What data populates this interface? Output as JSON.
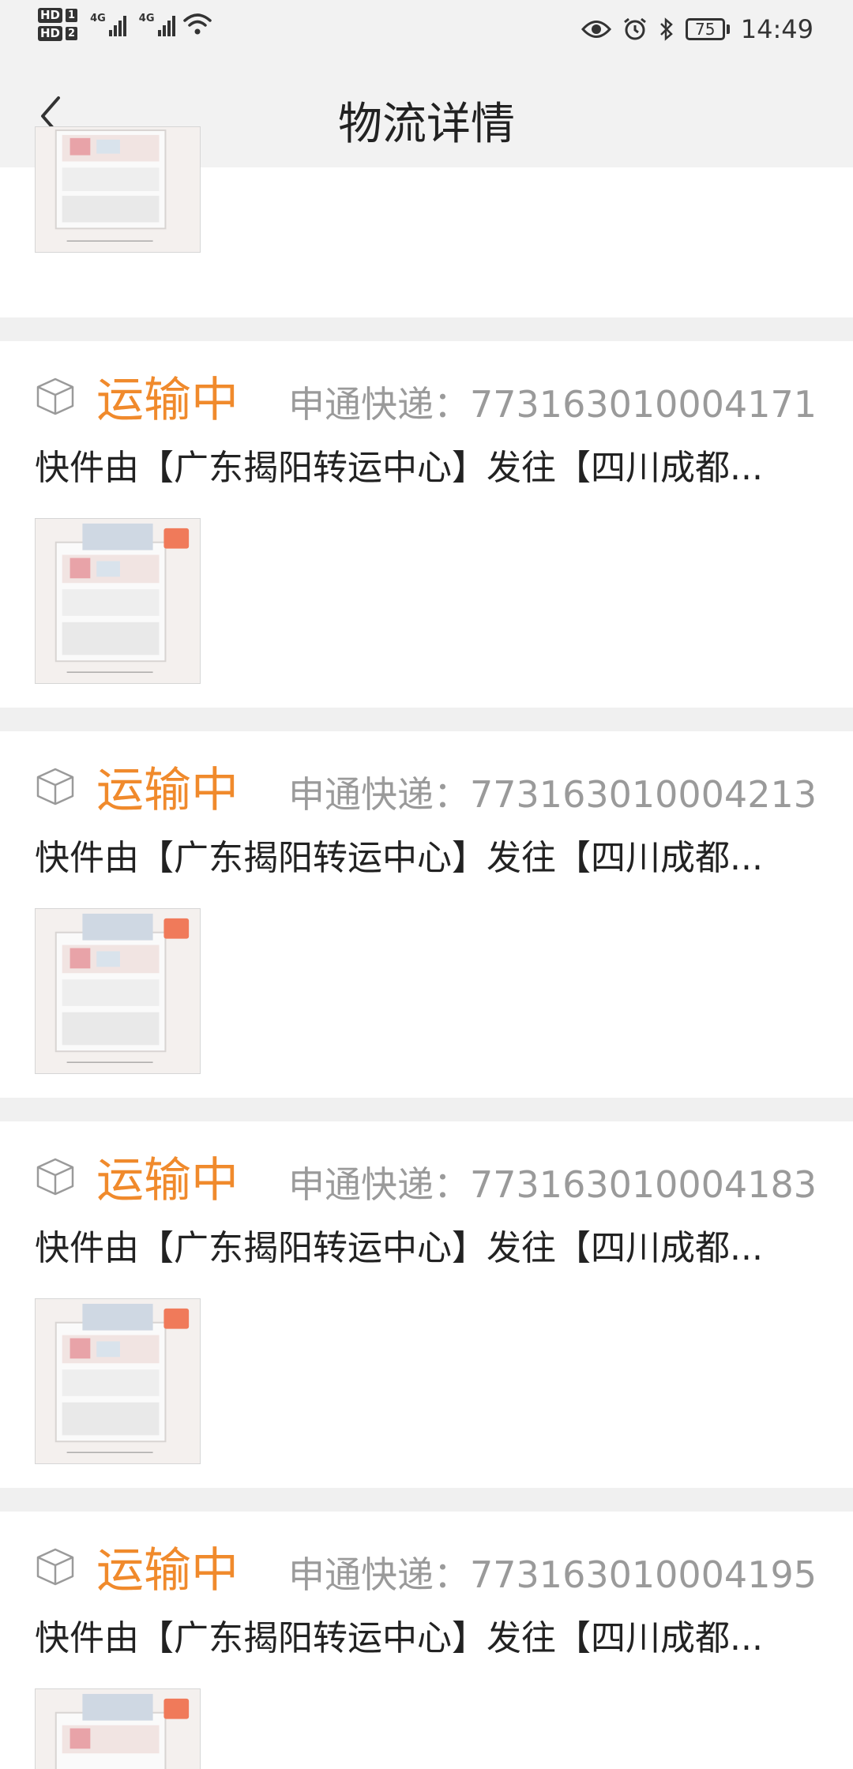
{
  "status_bar": {
    "hd1": "HD",
    "hd1_num": "1",
    "hd2": "HD",
    "hd2_num": "2",
    "net1": "4G",
    "net2": "4G",
    "battery": "75",
    "time": "14:49"
  },
  "nav": {
    "title": "物流详情"
  },
  "colors": {
    "status_orange": "#f08a2c",
    "courier_gray": "#9a9a9a",
    "divider_bg": "#f0f0f0"
  },
  "shipments": [
    {
      "status": "运输中",
      "courier": "申通快递：773163010004171",
      "detail": "快件由【广东揭阳转运中心】发往【四川成都..."
    },
    {
      "status": "运输中",
      "courier": "申通快递：773163010004213",
      "detail": "快件由【广东揭阳转运中心】发往【四川成都..."
    },
    {
      "status": "运输中",
      "courier": "申通快递：773163010004183",
      "detail": "快件由【广东揭阳转运中心】发往【四川成都..."
    },
    {
      "status": "运输中",
      "courier": "申通快递：773163010004195",
      "detail": "快件由【广东揭阳转运中心】发往【四川成都..."
    }
  ],
  "icons": {
    "shipment": "package-box-icon",
    "back": "chevron-left-icon"
  }
}
